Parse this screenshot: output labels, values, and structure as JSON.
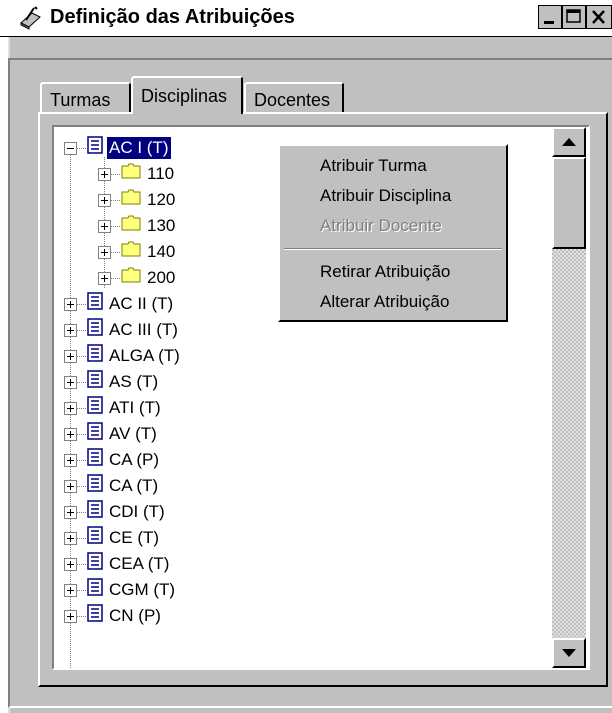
{
  "window": {
    "title": "Definição das Atribuições",
    "controls": [
      "minimize",
      "maximize",
      "close"
    ]
  },
  "tabs": [
    {
      "label": "Turmas",
      "active": false
    },
    {
      "label": "Disciplinas",
      "active": true
    },
    {
      "label": "Docentes",
      "active": false
    }
  ],
  "tree": {
    "selected": "AC I (T)",
    "items": [
      {
        "label": "AC I (T)",
        "type": "discipline",
        "expanded": true
      },
      {
        "label": "110",
        "type": "folder"
      },
      {
        "label": "120",
        "type": "folder"
      },
      {
        "label": "130",
        "type": "folder"
      },
      {
        "label": "140",
        "type": "folder"
      },
      {
        "label": "200",
        "type": "folder"
      },
      {
        "label": "AC II (T)",
        "type": "discipline"
      },
      {
        "label": "AC III (T)",
        "type": "discipline"
      },
      {
        "label": "ALGA (T)",
        "type": "discipline"
      },
      {
        "label": "AS (T)",
        "type": "discipline"
      },
      {
        "label": "ATI (T)",
        "type": "discipline"
      },
      {
        "label": "AV (T)",
        "type": "discipline"
      },
      {
        "label": "CA (P)",
        "type": "discipline"
      },
      {
        "label": "CA (T)",
        "type": "discipline"
      },
      {
        "label": "CDI (T)",
        "type": "discipline"
      },
      {
        "label": "CE (T)",
        "type": "discipline"
      },
      {
        "label": "CEA (T)",
        "type": "discipline"
      },
      {
        "label": "CGM (T)",
        "type": "discipline"
      },
      {
        "label": "CN (P)",
        "type": "discipline"
      }
    ]
  },
  "context_menu": {
    "items": [
      {
        "label": "Atribuir Turma",
        "enabled": true
      },
      {
        "label": "Atribuir Disciplina",
        "enabled": true
      },
      {
        "label": "Atribuir Docente",
        "enabled": false
      },
      {
        "label": "Retirar Atribuição",
        "enabled": true
      },
      {
        "label": "Alterar Atribuição",
        "enabled": true
      }
    ]
  },
  "colors": {
    "face": "#c0c0c0",
    "selection": "#000080",
    "folder": "#ffff80",
    "doc_icon": "#000080"
  }
}
